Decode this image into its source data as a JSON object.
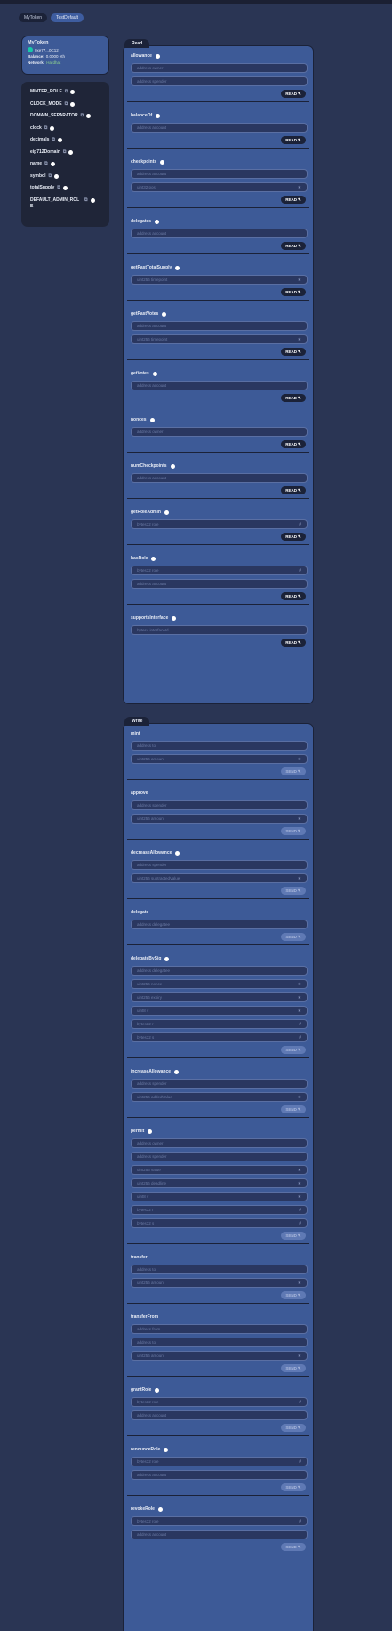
{
  "tabs": [
    "MyToken",
    "TestDefault"
  ],
  "token": {
    "name": "MyToken",
    "address": "0xe77...0C12",
    "balance_label": "Balance:",
    "balance": "0.0000 eth",
    "network_label": "Network:",
    "network": "Hardhat"
  },
  "properties": [
    "MINTER_ROLE",
    "CLOCK_MODE",
    "DOMAIN_SEPARATOR",
    "clock",
    "decimals",
    "eip712Domain",
    "name",
    "symbol",
    "totalSupply",
    "DEFAULT_ADMIN_ROLE"
  ],
  "read_panel": {
    "title": "Read",
    "button_label": "READ",
    "functions": [
      {
        "name": "allowance",
        "info": true,
        "inputs": [
          "address owner",
          "address spender"
        ],
        "suffix": [
          "",
          ""
        ]
      },
      {
        "name": "balanceOf",
        "info": true,
        "inputs": [
          "address account"
        ],
        "suffix": [
          ""
        ]
      },
      {
        "name": "checkpoints",
        "info": true,
        "inputs": [
          "address account",
          "uint32 pos"
        ],
        "suffix": [
          "",
          "∗"
        ]
      },
      {
        "name": "delegates",
        "info": true,
        "inputs": [
          "address account"
        ],
        "suffix": [
          ""
        ]
      },
      {
        "name": "getPastTotalSupply",
        "info": true,
        "inputs": [
          "uint256 timepoint"
        ],
        "suffix": [
          "∗"
        ]
      },
      {
        "name": "getPastVotes",
        "info": true,
        "inputs": [
          "address account",
          "uint256 timepoint"
        ],
        "suffix": [
          "",
          "∗"
        ]
      },
      {
        "name": "getVotes",
        "info": true,
        "inputs": [
          "address account"
        ],
        "suffix": [
          ""
        ]
      },
      {
        "name": "nonces",
        "info": true,
        "inputs": [
          "address owner"
        ],
        "suffix": [
          ""
        ]
      },
      {
        "name": "numCheckpoints",
        "info": true,
        "inputs": [
          "address account"
        ],
        "suffix": [
          ""
        ]
      },
      {
        "name": "getRoleAdmin",
        "info": true,
        "inputs": [
          "bytes32 role"
        ],
        "suffix": [
          "#"
        ]
      },
      {
        "name": "hasRole",
        "info": true,
        "inputs": [
          "bytes32 role",
          "address account"
        ],
        "suffix": [
          "#",
          ""
        ]
      },
      {
        "name": "supportsInterface",
        "info": true,
        "inputs": [
          "bytes4 interfaceId"
        ],
        "suffix": [
          ""
        ]
      }
    ]
  },
  "write_panel": {
    "title": "Write",
    "button_label": "SEND",
    "functions": [
      {
        "name": "mint",
        "info": false,
        "inputs": [
          "address to",
          "uint256 amount"
        ],
        "suffix": [
          "",
          "∗"
        ]
      },
      {
        "name": "approve",
        "info": false,
        "inputs": [
          "address spender",
          "uint256 amount"
        ],
        "suffix": [
          "",
          "∗"
        ]
      },
      {
        "name": "decreaseAllowance",
        "info": true,
        "inputs": [
          "address spender",
          "uint256 subtractedValue"
        ],
        "suffix": [
          "",
          "∗"
        ]
      },
      {
        "name": "delegate",
        "info": false,
        "inputs": [
          "address delegatee"
        ],
        "suffix": [
          ""
        ]
      },
      {
        "name": "delegateBySig",
        "info": true,
        "inputs": [
          "address delegatee",
          "uint256 nonce",
          "uint256 expiry",
          "uint8 v",
          "bytes32 r",
          "bytes32 s"
        ],
        "suffix": [
          "",
          "∗",
          "∗",
          "∗",
          "#",
          "#"
        ]
      },
      {
        "name": "increaseAllowance",
        "info": true,
        "inputs": [
          "address spender",
          "uint256 addedValue"
        ],
        "suffix": [
          "",
          "∗"
        ]
      },
      {
        "name": "permit",
        "info": true,
        "inputs": [
          "address owner",
          "address spender",
          "uint256 value",
          "uint256 deadline",
          "uint8 v",
          "bytes32 r",
          "bytes32 s"
        ],
        "suffix": [
          "",
          "",
          "∗",
          "∗",
          "∗",
          "#",
          "#"
        ]
      },
      {
        "name": "transfer",
        "info": false,
        "inputs": [
          "address to",
          "uint256 amount"
        ],
        "suffix": [
          "",
          "∗"
        ]
      },
      {
        "name": "transferFrom",
        "info": false,
        "inputs": [
          "address from",
          "address to",
          "uint256 amount"
        ],
        "suffix": [
          "",
          "",
          "∗"
        ]
      },
      {
        "name": "grantRole",
        "info": true,
        "inputs": [
          "bytes32 role",
          "address account"
        ],
        "suffix": [
          "#",
          ""
        ]
      },
      {
        "name": "renounceRole",
        "info": true,
        "inputs": [
          "bytes32 role",
          "address account"
        ],
        "suffix": [
          "#",
          ""
        ]
      },
      {
        "name": "revokeRole",
        "info": true,
        "inputs": [
          "bytes32 role",
          "address account"
        ],
        "suffix": [
          "#",
          ""
        ]
      }
    ]
  }
}
